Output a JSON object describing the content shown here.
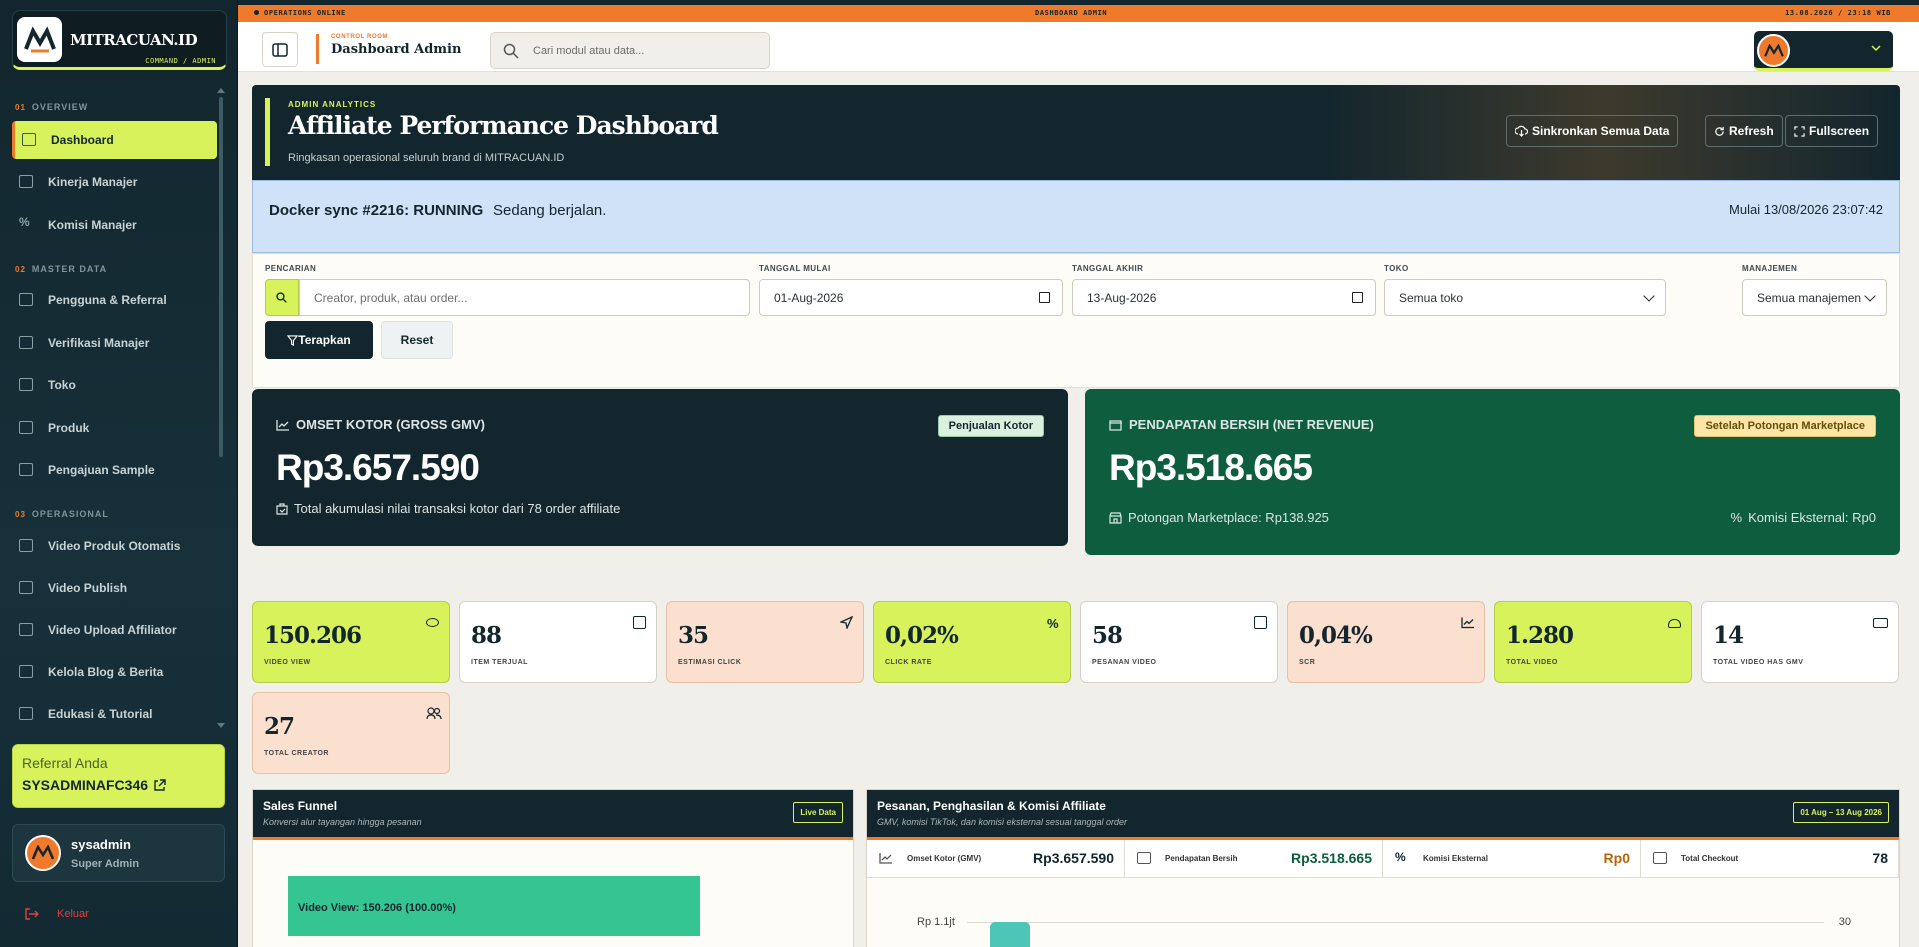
{
  "colors": {
    "lime": "#d7f25b",
    "orange": "#f07a2c",
    "navy": "#13262d",
    "green": "#0d5d3e",
    "peach": "#fbdfcf"
  },
  "brand": {
    "name": "MITRACUAN.ID",
    "sub": "COMMAND / ADMIN"
  },
  "sidebar": {
    "sections": [
      {
        "num": "01",
        "label": "OVERVIEW"
      },
      {
        "num": "02",
        "label": "MASTER DATA"
      },
      {
        "num": "03",
        "label": "OPERASIONAL"
      }
    ],
    "items": [
      {
        "label": "Dashboard",
        "icon": "dashboard-icon"
      },
      {
        "label": "Kinerja Manajer",
        "icon": "chart-icon"
      },
      {
        "label": "Komisi Manajer",
        "icon": "percent-icon"
      },
      {
        "label": "Pengguna & Referral",
        "icon": "users-icon"
      },
      {
        "label": "Verifikasi Manajer",
        "icon": "id-card-icon"
      },
      {
        "label": "Toko",
        "icon": "store-icon"
      },
      {
        "label": "Produk",
        "icon": "box-icon"
      },
      {
        "label": "Pengajuan Sample",
        "icon": "gift-icon"
      },
      {
        "label": "Video Produk Otomatis",
        "icon": "film-icon"
      },
      {
        "label": "Video Publish",
        "icon": "play-icon"
      },
      {
        "label": "Video Upload Affiliator",
        "icon": "upload-video-icon"
      },
      {
        "label": "Kelola Blog & Berita",
        "icon": "newspaper-icon"
      },
      {
        "label": "Edukasi & Tutorial",
        "icon": "book-icon"
      }
    ],
    "referral": {
      "label": "Referral Anda",
      "code": "SYSADMINAFC346"
    },
    "user": {
      "name": "sysadmin",
      "role": "Super Admin"
    },
    "logout": "Keluar"
  },
  "strip": {
    "left": "OPERATIONS ONLINE",
    "center": "DASHBOARD ADMIN",
    "right": "13.08.2026 / 23:18 WIB"
  },
  "topbar": {
    "kicker": "CONTROL ROOM",
    "title": "Dashboard Admin",
    "search_placeholder": "Cari modul atau data..."
  },
  "hero": {
    "kicker": "ADMIN ANALYTICS",
    "title": "Affiliate Performance Dashboard",
    "subtitle": "Ringkasan operasional seluruh brand di MITRACUAN.ID",
    "buttons": [
      "Sinkronkan Semua Data",
      "Refresh",
      "Fullscreen"
    ]
  },
  "sync": {
    "title": "Docker sync #2216: RUNNING",
    "status": "Sedang berjalan.",
    "started": "Mulai 13/08/2026 23:07:42"
  },
  "filters": {
    "search_label": "PENCARIAN",
    "search_placeholder": "Creator, produk, atau order...",
    "start_label": "TANGGAL MULAI",
    "start_value": "01-Aug-2026",
    "end_label": "TANGGAL AKHIR",
    "end_value": "13-Aug-2026",
    "store_label": "TOKO",
    "store_value": "Semua toko",
    "mgmt_label": "MANAJEMEN",
    "mgmt_value": "Semua manajemen",
    "apply": "Terapkan",
    "reset": "Reset"
  },
  "gmv": {
    "title": "OMSET KOTOR (GROSS GMV)",
    "badge": "Penjualan Kotor",
    "value": "Rp3.657.590",
    "sub": "Total akumulasi nilai transaksi kotor dari 78 order affiliate"
  },
  "net": {
    "title": "PENDAPATAN BERSIH (NET REVENUE)",
    "badge": "Setelah Potongan Marketplace",
    "value": "Rp3.518.665",
    "cut": "Potongan Marketplace: Rp138.925",
    "ext": "Komisi Eksternal: Rp0"
  },
  "stats": [
    {
      "value": "150.206",
      "label": "VIDEO VIEW",
      "icon": "eye-icon",
      "tone": "lime"
    },
    {
      "value": "88",
      "label": "ITEM TERJUAL",
      "icon": "bag-icon",
      "tone": "white"
    },
    {
      "value": "35",
      "label": "ESTIMASI CLICK",
      "icon": "cursor-icon",
      "tone": "peach"
    },
    {
      "value": "0,02%",
      "label": "CLICK RATE",
      "icon": "percent-icon",
      "tone": "lime"
    },
    {
      "value": "58",
      "label": "PESANAN VIDEO",
      "icon": "receipt-icon",
      "tone": "white"
    },
    {
      "value": "0,04%",
      "label": "SCR",
      "icon": "trend-icon",
      "tone": "peach"
    },
    {
      "value": "1.280",
      "label": "TOTAL VIDEO",
      "icon": "cloud-icon",
      "tone": "lime"
    },
    {
      "value": "14",
      "label": "TOTAL VIDEO HAS GMV",
      "icon": "video-icon",
      "tone": "white"
    },
    {
      "value": "27",
      "label": "TOTAL CREATOR",
      "icon": "users-icon",
      "tone": "peach"
    }
  ],
  "funnel": {
    "title": "Sales Funnel",
    "subtitle": "Konversi alur tayangan hingga pesanan",
    "badge": "Live Data",
    "bar_label": "Video View: 150.206 (100.00%)",
    "bar_pct": 100
  },
  "orders": {
    "title": "Pesanan, Penghasilan & Komisi Affiliate",
    "subtitle": "GMV, komisi TikTok, dan komisi eksternal sesuai tanggal order",
    "range": "01 Aug – 13 Aug 2026",
    "metrics": [
      {
        "label": "Omset Kotor (GMV)",
        "value": "Rp3.657.590",
        "color": "#13262d"
      },
      {
        "label": "Pendapatan Bersih",
        "value": "Rp3.518.665",
        "color": "#0d5d3e"
      },
      {
        "label": "Komisi Eksternal",
        "value": "Rp0",
        "color": "#b7650b"
      },
      {
        "label": "Total Checkout",
        "value": "78",
        "color": "#13262d"
      }
    ],
    "y_left": "Rp 1.1jt",
    "y_right": "30"
  }
}
